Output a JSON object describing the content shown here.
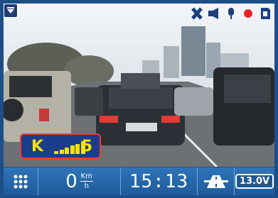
{
  "overlay": {
    "gps_label": "K",
    "gps_count": "5",
    "gps_bars": [
      0.2,
      0.35,
      0.5,
      0.65,
      0.8,
      1.0
    ],
    "icons": [
      "disconnect-icon",
      "speaker-icon",
      "microphone-icon",
      "record-dot-icon",
      "sd-card-icon"
    ],
    "colors": {
      "gps_text": "#f7e300",
      "gps_bg": "#1c3d8b",
      "gps_border": "#ef3b2d"
    }
  },
  "statusbar": {
    "speed": "0",
    "speed_unit_top": "Km",
    "speed_unit_bottom": "h",
    "time": "15:13",
    "voltage": "13.0V",
    "icons": [
      "grid-menu-icon",
      "road-icon"
    ],
    "colors": {
      "bar": "#2f74b9",
      "text": "#ffffff"
    }
  }
}
